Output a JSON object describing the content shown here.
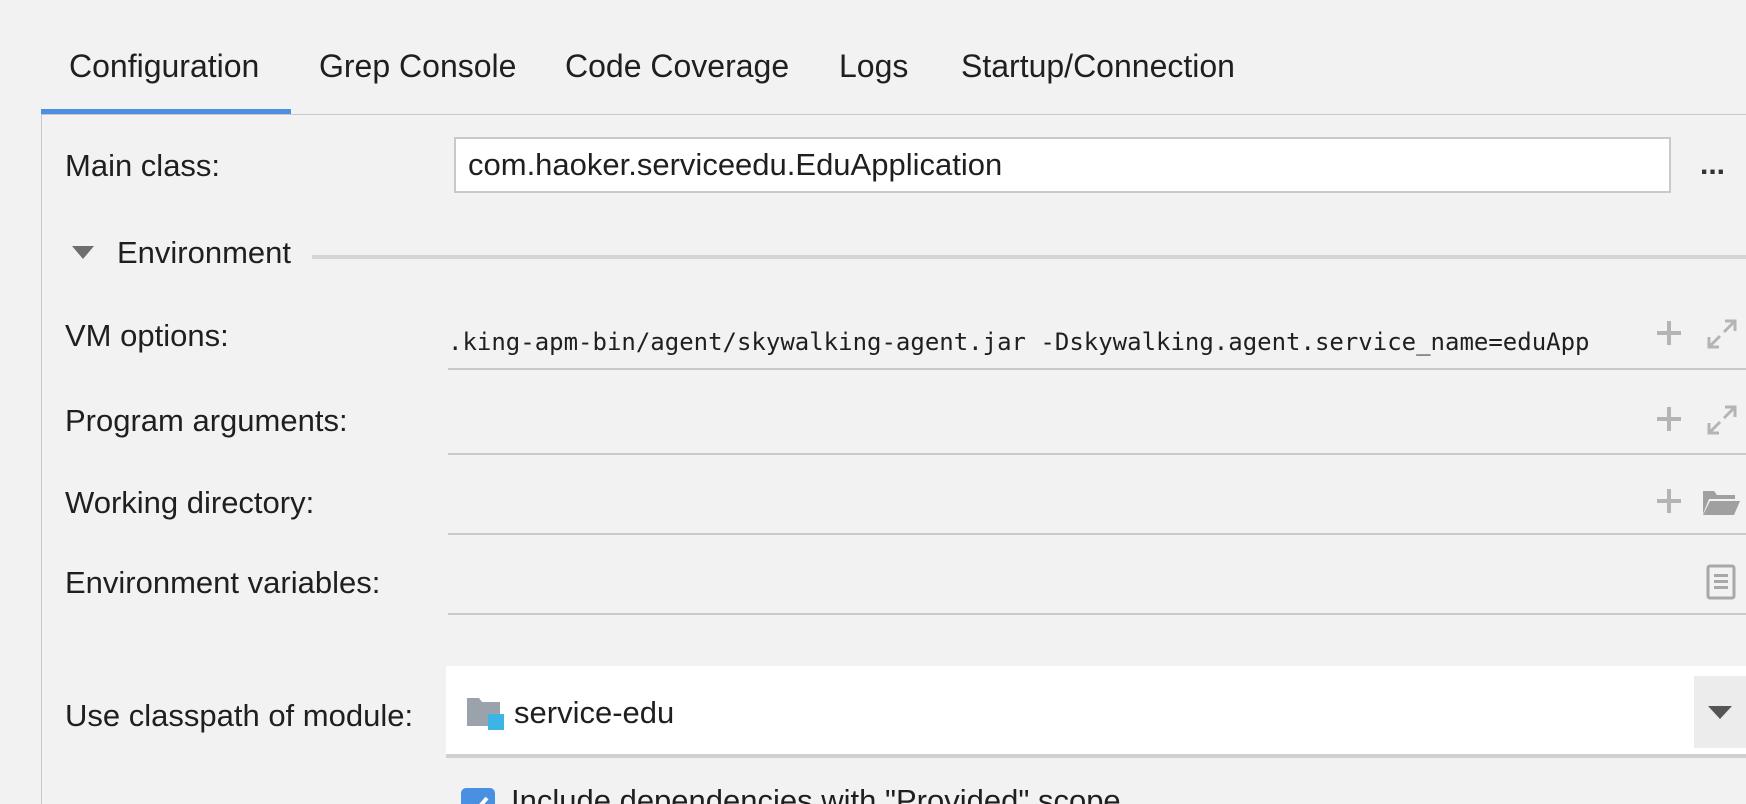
{
  "tabs": [
    {
      "label": "Configuration",
      "active": true
    },
    {
      "label": "Grep Console",
      "active": false
    },
    {
      "label": "Code Coverage",
      "active": false
    },
    {
      "label": "Logs",
      "active": false
    },
    {
      "label": "Startup/Connection",
      "active": false
    }
  ],
  "main_class": {
    "label": "Main class:",
    "value": "com.haoker.serviceedu.EduApplication",
    "browse_label": "..."
  },
  "environment": {
    "title": "Environment",
    "expanded": true
  },
  "vm_options": {
    "label": "VM options:",
    "value": ".king-apm-bin/agent/skywalking-agent.jar -Dskywalking.agent.service_name=eduApp"
  },
  "program_arguments": {
    "label": "Program arguments:",
    "value": ""
  },
  "working_directory": {
    "label": "Working directory:",
    "value": ""
  },
  "environment_variables": {
    "label": "Environment variables:",
    "value": ""
  },
  "classpath_module": {
    "label": "Use classpath of module:",
    "value": "service-edu"
  },
  "include_provided": {
    "label": "Include dependencies with \"Provided\" scope",
    "checked": true
  },
  "colors": {
    "accent": "#4d8fe0",
    "background": "#f2f2f2",
    "checkbox": "#4a90e2",
    "module_badge": "#3cb4e6"
  },
  "icons": {
    "expand_arguments": "plus-icon",
    "expand_editor": "expand-icon",
    "browse_folder": "folder-icon",
    "edit_variables": "document-icon",
    "module": "module-folder-icon",
    "dropdown": "chevron-down-icon"
  }
}
